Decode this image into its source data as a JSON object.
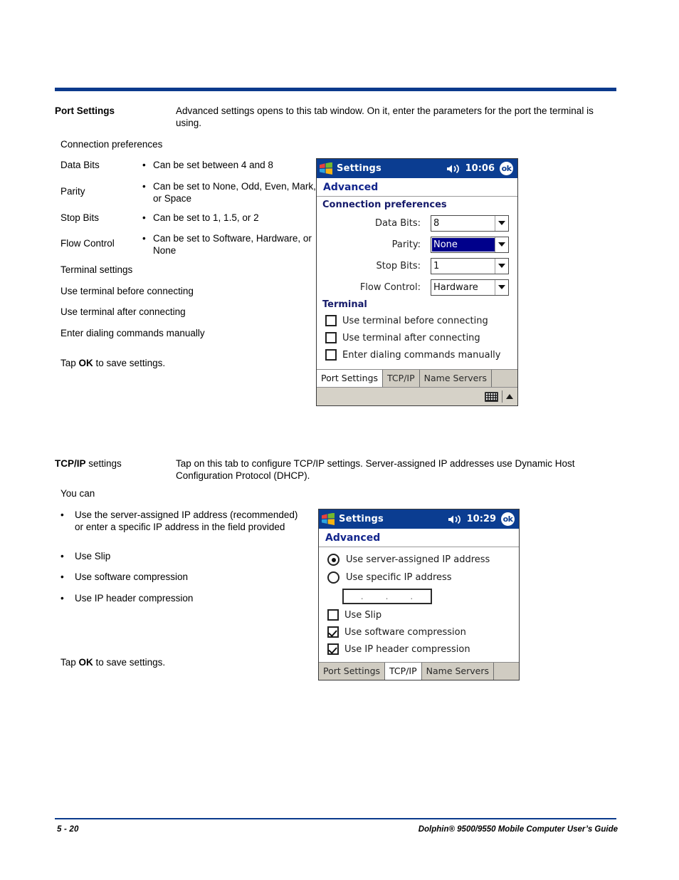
{
  "section1": {
    "heading": "Port Settings",
    "body": "Advanced settings opens to this tab window. On it, enter the parameters for the port the terminal is using.",
    "connection_preferences_label": "Connection preferences",
    "rows": [
      {
        "term": "Data Bits",
        "bullet": "•",
        "desc": "Can be set between 4 and 8"
      },
      {
        "term": "Parity",
        "bullet": "•",
        "desc": "Can be set to None, Odd, Even, Mark, or Space"
      },
      {
        "term": "Stop Bits",
        "bullet": "•",
        "desc": "Can be set to 1, 1.5, or 2"
      },
      {
        "term": "Flow Control",
        "bullet": "•",
        "desc": "Can be set to Software, Hardware, or None"
      }
    ],
    "terminal_settings_label": "Terminal settings",
    "terminal_lines": [
      "Use terminal before connecting",
      "Use terminal after connecting",
      "Enter dialing commands manually"
    ],
    "tap_ok_prefix": "Tap ",
    "tap_ok_bold": "OK",
    "tap_ok_suffix": " to save settings."
  },
  "section2": {
    "heading_bold": "TCP/IP",
    "heading_rest": " settings",
    "body": "Tap on this tab to configure TCP/IP settings. Server-assigned IP addresses use Dynamic Host Configuration Protocol (DHCP).",
    "you_can_label": "You can",
    "bullets": [
      "Use the server-assigned IP address (recommended) or enter a specific IP address in the field provided",
      "Use Slip",
      "Use software compression",
      "Use IP header compression"
    ],
    "bullet_char": "•",
    "tap_ok_prefix": "Tap ",
    "tap_ok_bold": "OK",
    "tap_ok_suffix": " to save settings."
  },
  "pda1": {
    "title": "Settings",
    "clock": "10:06",
    "ok_label": "ok",
    "subtitle": "Advanced",
    "section_heading": "Connection preferences",
    "fields": [
      {
        "label": "Data Bits:",
        "value": "8",
        "selected": false
      },
      {
        "label": "Parity:",
        "value": "None",
        "selected": true
      },
      {
        "label": "Stop Bits:",
        "value": "1",
        "selected": false
      },
      {
        "label": "Flow Control:",
        "value": "Hardware",
        "selected": false
      }
    ],
    "terminal_heading": "Terminal",
    "checkboxes": [
      {
        "label": "Use terminal before connecting",
        "checked": false
      },
      {
        "label": "Use terminal after connecting",
        "checked": false
      },
      {
        "label": "Enter dialing commands manually",
        "checked": false
      }
    ],
    "tabs": [
      {
        "label": "Port Settings",
        "active": true
      },
      {
        "label": "TCP/IP",
        "active": false
      },
      {
        "label": "Name Servers",
        "active": false
      }
    ]
  },
  "pda2": {
    "title": "Settings",
    "clock": "10:29",
    "ok_label": "ok",
    "subtitle": "Advanced",
    "radios": [
      {
        "label": "Use server-assigned IP address",
        "selected": true
      },
      {
        "label": "Use specific IP address",
        "selected": false
      }
    ],
    "ip_field": {
      "octets": [
        "",
        "",
        "",
        ""
      ],
      "separator": "."
    },
    "checkboxes": [
      {
        "label": "Use Slip",
        "checked": false
      },
      {
        "label": "Use software compression",
        "checked": true
      },
      {
        "label": "Use IP header compression",
        "checked": true
      }
    ],
    "tabs": [
      {
        "label": "Port Settings",
        "active": false
      },
      {
        "label": "TCP/IP",
        "active": true
      },
      {
        "label": "Name Servers",
        "active": false
      }
    ]
  },
  "footer": {
    "page_number": "5 - 20",
    "guide_title": "Dolphin® 9500/9550 Mobile Computer User’s Guide"
  },
  "colors": {
    "rule_blue": "#0b3a8c",
    "titlebar_blue": "#0b3d91",
    "subtitle_blue": "#12258c",
    "selection_blue": "#00008b",
    "tab_gray": "#d6d2c8"
  }
}
